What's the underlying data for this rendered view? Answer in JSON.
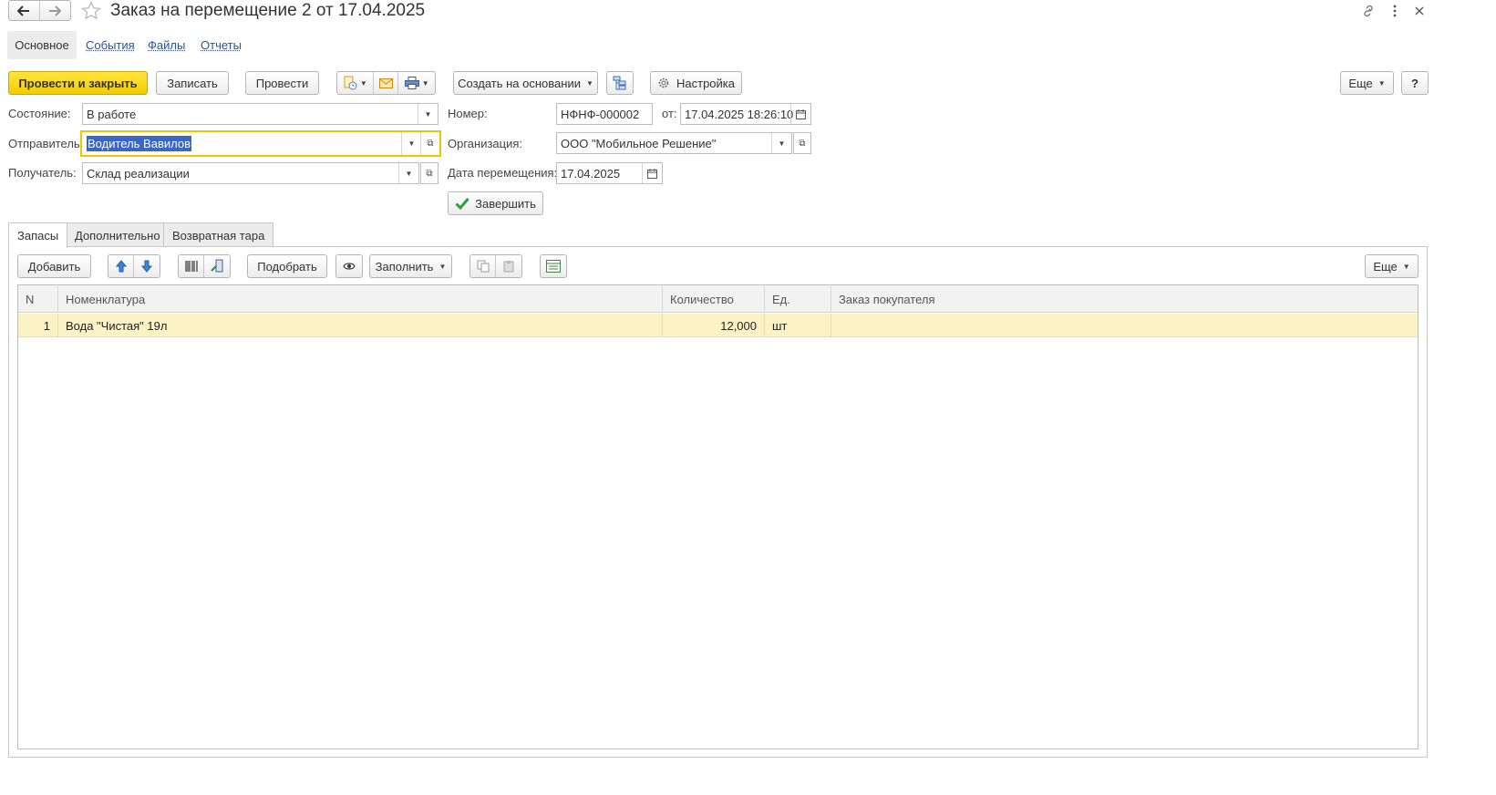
{
  "window": {
    "title": "Заказ на перемещение 2 от 17.04.2025",
    "icons": [
      "back-arrow-icon",
      "forward-arrow-icon",
      "star-icon",
      "link-icon",
      "more-vertical-icon",
      "close-icon"
    ]
  },
  "nav_tabs": [
    {
      "label": "Основное",
      "active": true
    },
    {
      "label": "События",
      "active": false
    },
    {
      "label": "Файлы",
      "active": false
    },
    {
      "label": "Отчеты",
      "active": false
    }
  ],
  "toolbar": {
    "post_close": "Провести и закрыть",
    "save": "Записать",
    "post": "Провести",
    "create_based": "Создать на основании",
    "settings": "Настройка",
    "more": "Еще",
    "help": "?"
  },
  "form": {
    "state_label": "Состояние:",
    "state_value": "В работе",
    "sender_label": "Отправитель:",
    "sender_value": "Водитель Вавилов",
    "receiver_label": "Получатель:",
    "receiver_value": "Склад реализации",
    "number_label": "Номер:",
    "number_value": "НФНФ-000002",
    "from_label": "от:",
    "from_value": "17.04.2025 18:26:10",
    "org_label": "Организация:",
    "org_value": "ООО \"Мобильное Решение\"",
    "move_date_label": "Дата перемещения:",
    "move_date_value": "17.04.2025",
    "finish_button": "Завершить"
  },
  "content_tabs": [
    {
      "label": "Запасы",
      "active": true
    },
    {
      "label": "Дополнительно",
      "active": false
    },
    {
      "label": "Возвратная тара",
      "active": false
    }
  ],
  "table_toolbar": {
    "add": "Добавить",
    "pick": "Подобрать",
    "fill": "Заполнить",
    "more": "Еще"
  },
  "table": {
    "columns": [
      "N",
      "Номенклатура",
      "Количество",
      "Ед.",
      "Заказ покупателя"
    ],
    "rows": [
      {
        "n": "1",
        "item": "Вода \"Чистая\" 19л",
        "qty": "12,000",
        "unit": "шт",
        "order": ""
      }
    ]
  },
  "colors": {
    "accent_yellow": "#f5d20a",
    "selected_row": "#fbf2c6",
    "link": "#2255a4",
    "selection": "#3b66c4"
  }
}
